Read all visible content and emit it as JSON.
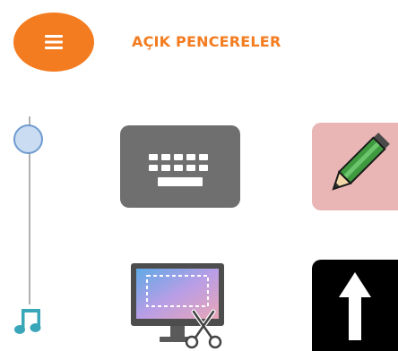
{
  "header": {
    "title": "AÇIK PENCERELER",
    "menu_icon": "hamburger-menu-icon",
    "accent_color": "#f47c20"
  },
  "slider": {
    "level": 0.05,
    "end_icon": "music-note-icon"
  },
  "tiles": [
    {
      "name": "keyboard-tile",
      "icon": "keyboard-icon",
      "background": "#6f6f6f"
    },
    {
      "name": "pencil-tile",
      "icon": "pencil-icon",
      "background": "#e9b5b5"
    },
    {
      "name": "screen-snip-tile",
      "icon": "screen-snip-icon",
      "background": "#ffffff"
    },
    {
      "name": "up-arrow-tile",
      "icon": "up-arrow-icon",
      "background": "#000000"
    }
  ]
}
